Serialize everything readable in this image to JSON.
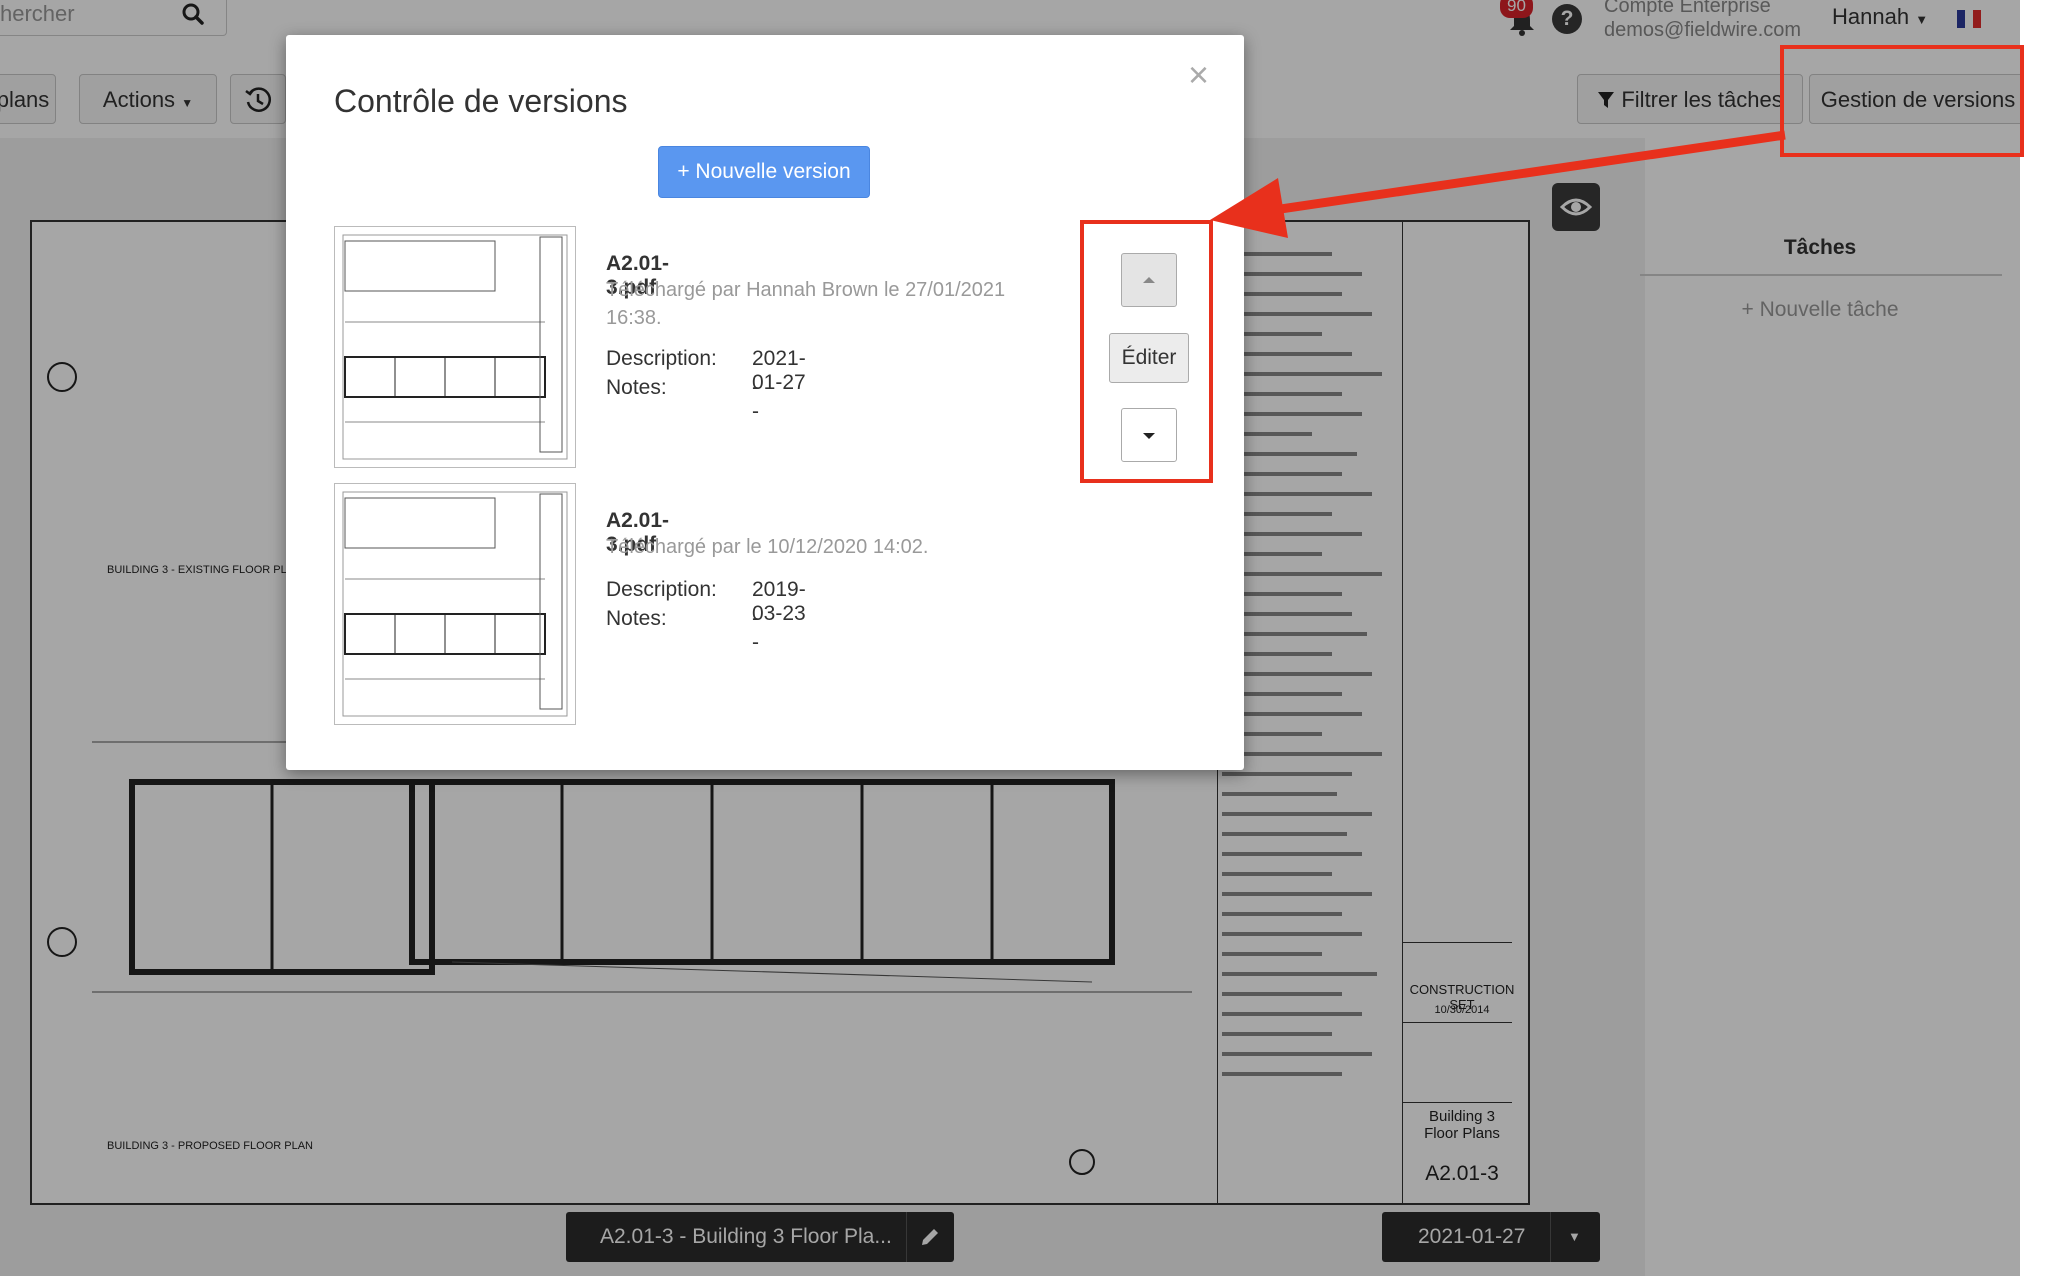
{
  "header": {
    "search_placeholder": "hercher",
    "notification_count": "90",
    "help_label": "?",
    "company_line1": "Compte Enterprise",
    "company_line2": "demos@fieldwire.com",
    "user_name": "Hannah"
  },
  "toolbar": {
    "plans_label": "plans",
    "actions_label": "Actions",
    "filter_tasks_label": "Filtrer les tâches",
    "version_management_label": "Gestion de versions"
  },
  "tasks_panel": {
    "title": "Tâches",
    "new_task_label": "+ Nouvelle tâche"
  },
  "bottom_bar": {
    "sheet_name": "A2.01-3 - Building 3 Floor Pla...",
    "version_date": "2021-01-27"
  },
  "modal": {
    "title": "Contrôle de versions",
    "new_version_label": "+ Nouvelle version",
    "edit_label": "Éditer",
    "versions": [
      {
        "filename": "A2.01-3.pdf",
        "uploaded": "Téléchargé par Hannah Brown le 27/01/2021 16:38.",
        "description_label": "Description:",
        "description": "2021-01-27",
        "notes_label": "Notes:",
        "notes": "--"
      },
      {
        "filename": "A2.01-3.pdf",
        "uploaded": "Téléchargé par le 10/12/2020 14:02.",
        "description_label": "Description:",
        "description": "2019-03-23",
        "notes_label": "Notes:",
        "notes": "--"
      }
    ]
  },
  "drawing": {
    "label_existing": "BUILDING 3 - EXISTING FLOOR PLA",
    "label_proposed": "BUILDING 3 - PROPOSED FLOOR PLAN",
    "construction_set": "CONSTRUCTION SET",
    "set_date": "10/30/2014",
    "sheet_title": "Building 3 Floor Plans",
    "sheet_number": "A2.01-3"
  },
  "colors": {
    "highlight": "#e8301c",
    "primary_button": "#5a97f0",
    "notification_badge": "#d9222a"
  },
  "icons": [
    "search-icon",
    "bell-icon",
    "help-icon",
    "history-icon",
    "filter-icon",
    "eye-icon",
    "close-icon",
    "caret-up-icon",
    "caret-down-icon",
    "pencil-icon",
    "flag-icon",
    "arrow-annotation"
  ]
}
